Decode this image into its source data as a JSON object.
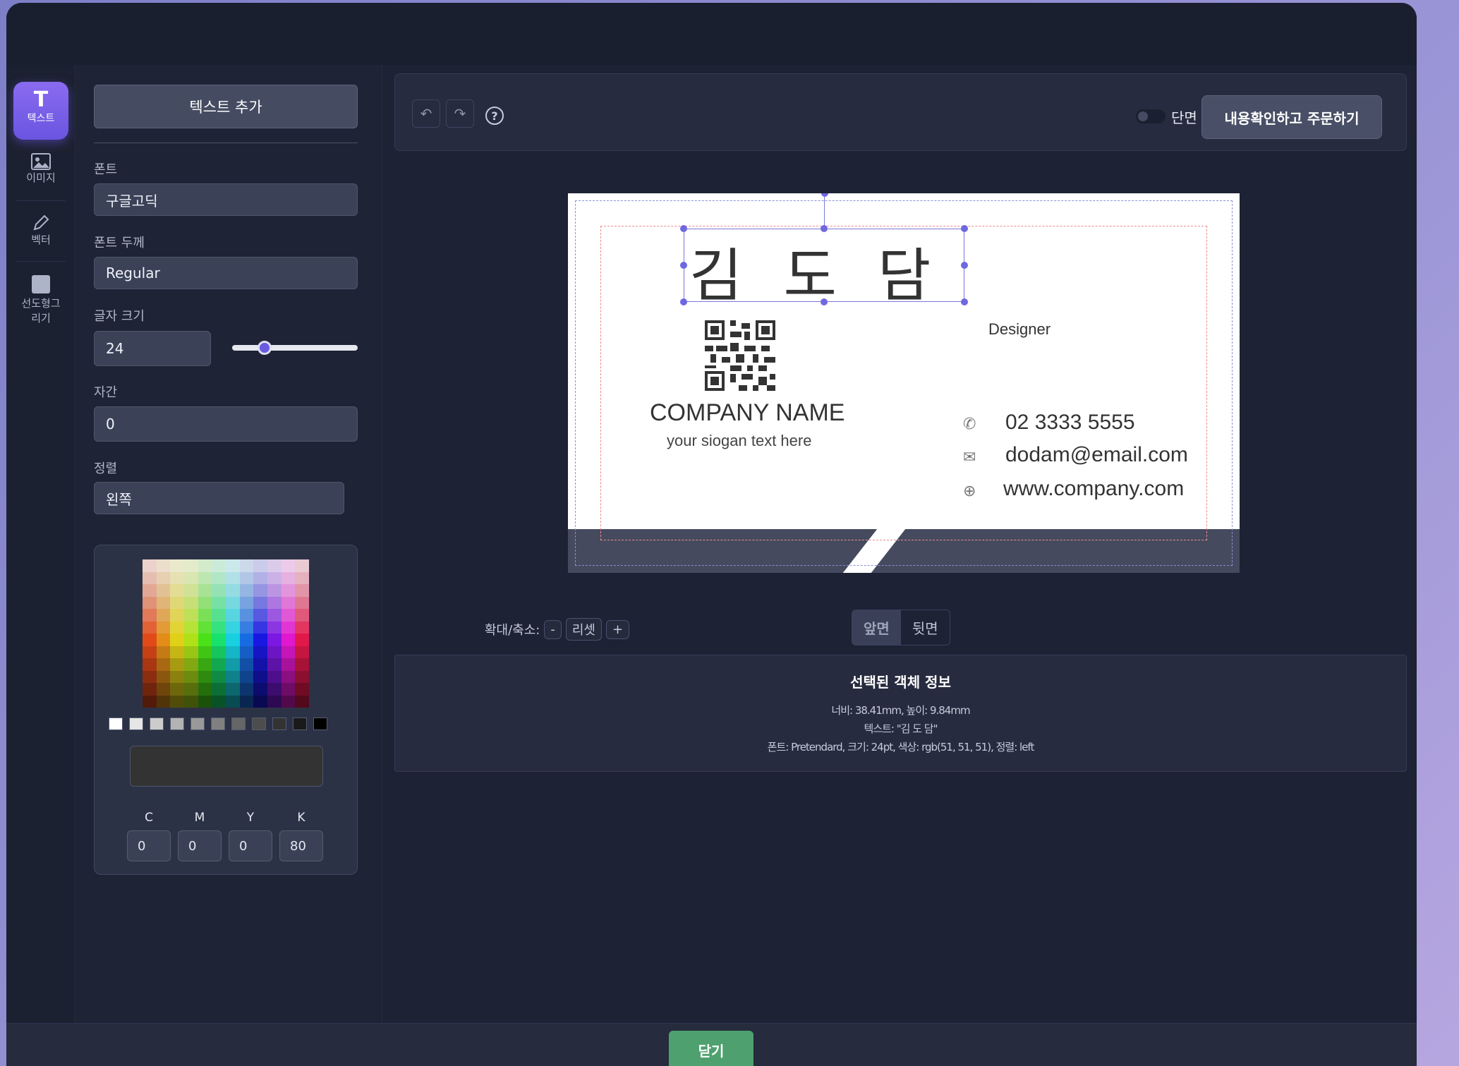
{
  "toolbar": {
    "items": [
      {
        "label": "텍스트",
        "glyph": "T"
      },
      {
        "label": "이미지"
      },
      {
        "label": "벡터"
      },
      {
        "label": "선도형그리기"
      }
    ]
  },
  "panel": {
    "add_text": "텍스트 추가",
    "font_label": "폰트",
    "font_value": "구글고딕",
    "weight_label": "폰트 두께",
    "weight_value": "Regular",
    "size_label": "글자 크기",
    "size_value": "24",
    "spacing_label": "자간",
    "spacing_value": "0",
    "align_label": "정렬",
    "align_value": "왼쪽",
    "preview_color": "#333333",
    "cmyk": [
      {
        "label": "C",
        "value": "0"
      },
      {
        "label": "M",
        "value": "0"
      },
      {
        "label": "Y",
        "value": "0"
      },
      {
        "label": "K",
        "value": "80"
      }
    ]
  },
  "topbar": {
    "undo_icon": "↶",
    "redo_icon": "↷",
    "help": "?",
    "single_side": "단면",
    "order_button": "내용확인하고 주문하기"
  },
  "card": {
    "name": "김도담",
    "title": "Designer",
    "company": "COMPANY NAME",
    "slogan": "your siogan text here",
    "phone": "02 3333 5555",
    "email": "dodam@email.com",
    "web": "www.company.com",
    "phone_icon": "✆",
    "email_icon": "✉",
    "web_icon": "⊕"
  },
  "zoom": {
    "label": "확대/축소:",
    "minus": "-",
    "reset": "리셋",
    "plus": "+"
  },
  "tabs": {
    "front": "앞면",
    "back": "뒷면"
  },
  "info": {
    "title": "선택된 객체 정보",
    "line1": "너비: 38.41mm, 높이: 9.84mm",
    "line2": "텍스트: \"김 도 담\"",
    "line3": "폰트: Pretendard, 크기: 24pt, 색상: rgb(51, 51, 51), 정렬: left"
  },
  "footer": {
    "close": "닫기"
  },
  "colors": {
    "accent": "#6a55e0",
    "close": "#4ea16f"
  }
}
